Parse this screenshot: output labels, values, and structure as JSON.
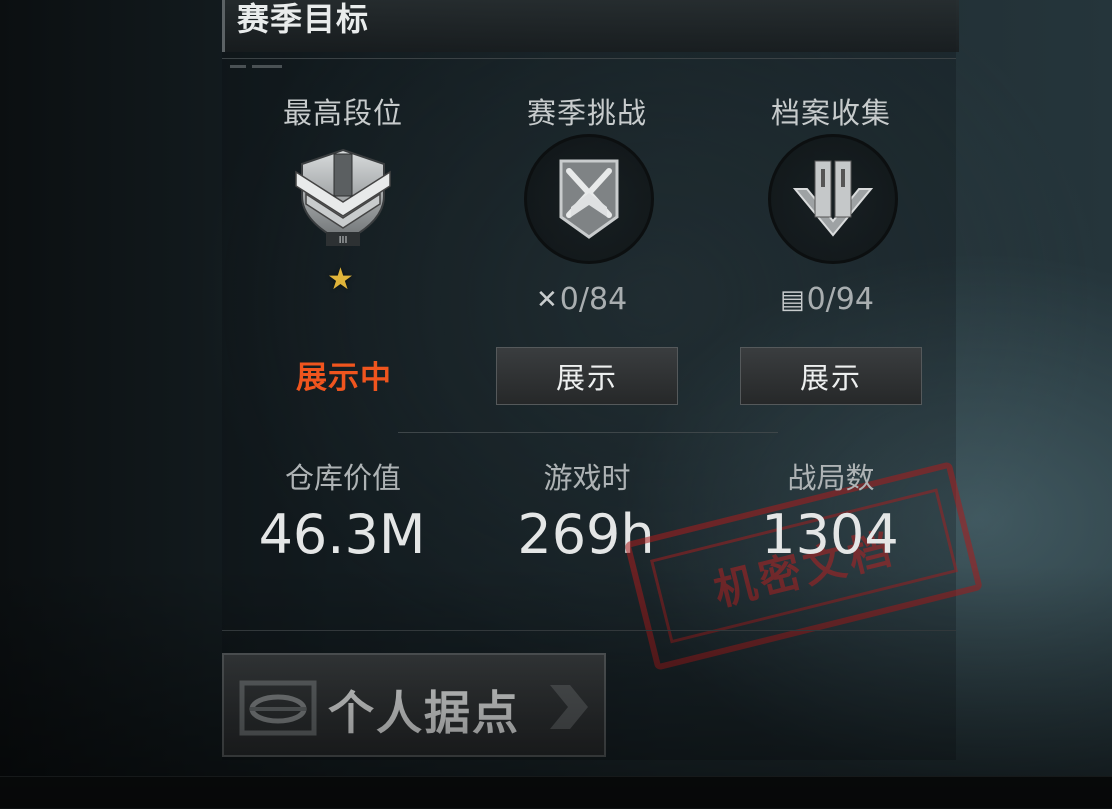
{
  "header": {
    "title": "赛季目标"
  },
  "goals": {
    "rank": {
      "title": "最高段位",
      "emblem_tier": "III",
      "status": "展示中"
    },
    "challenge": {
      "title": "赛季挑战",
      "progress": "0/84",
      "button": "展示"
    },
    "archive": {
      "title": "档案收集",
      "progress": "0/94",
      "button": "展示"
    }
  },
  "stats": {
    "warehouse": {
      "label": "仓库价值",
      "value": "46.3M"
    },
    "playtime": {
      "label": "游戏时",
      "value": "269h"
    },
    "matches": {
      "label": "战局数",
      "value": "1304"
    }
  },
  "stamp_text": "机密文档",
  "base_button": {
    "label": "个人据点"
  },
  "colors": {
    "accent": "#f0551e",
    "star": "#e0b43a",
    "stamp": "#b42323"
  }
}
